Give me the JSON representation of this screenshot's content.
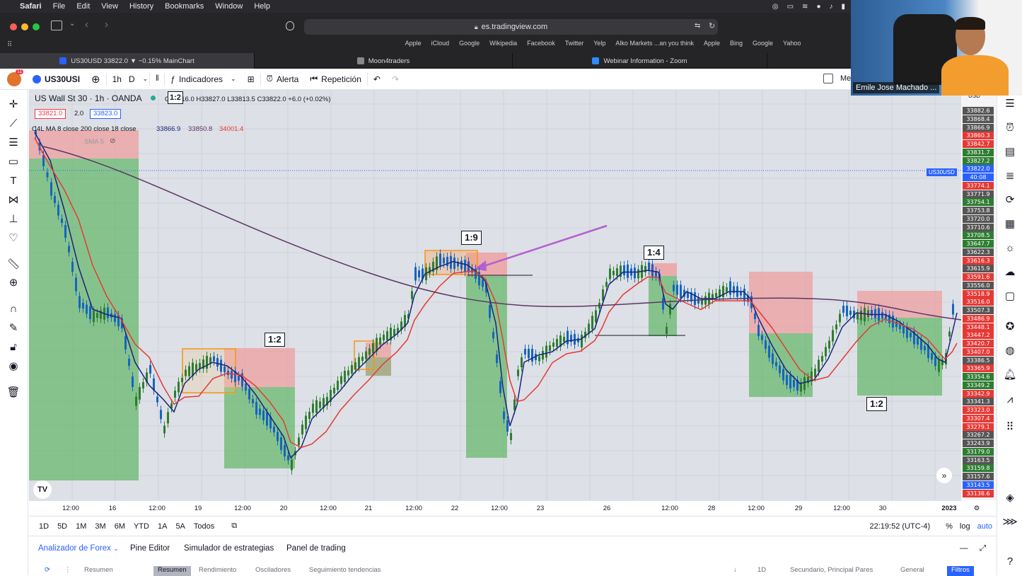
{
  "menubar": {
    "app": "Safari",
    "items": [
      "File",
      "Edit",
      "View",
      "History",
      "Bookmarks",
      "Window",
      "Help"
    ]
  },
  "safari": {
    "url": "es.tradingview.com",
    "favorites": [
      "Apple",
      "iCloud",
      "Google",
      "Wikipedia",
      "Facebook",
      "Twitter",
      "Yelp",
      "Alko Markets ...an you think",
      "Apple",
      "Bing",
      "Google",
      "Yahoo"
    ],
    "tabs": [
      {
        "label": "US30USD 33822.0 ▼ −0.15% MainChart",
        "color": "#2962ff"
      },
      {
        "label": "Moon4traders",
        "color": "#888888"
      },
      {
        "label": "Webinar Information - Zoom",
        "color": "#2d8cff"
      },
      {
        "label": "",
        "color": ""
      }
    ]
  },
  "tvtoolbar": {
    "avatar_badge": "11",
    "symbol": "US30USI",
    "interval": "1h",
    "chart_style_label": "D",
    "indicators": "Indicadores",
    "alert": "Alerta",
    "replay": "Repetición",
    "right_text": "Me"
  },
  "legend": {
    "title": "US Wall St 30 · 1h · OANDA",
    "ohlc": "O33816.0 H33827.0 L33813.5 C33822.0 +6.0 (+0.02%)",
    "bid": "33821.0",
    "spread": "2.0",
    "ask": "33823.0",
    "indicator_name": "C4L MA 8 close 200 close 18 close",
    "ma_values": [
      "33866.9",
      "33850.8",
      "34001.4"
    ],
    "ma_colors": [
      "#1a237e",
      "#5c3566",
      "#e53935"
    ],
    "sma_label": "SMA 5",
    "box_label": "1:2"
  },
  "annotations": [
    "1:2",
    "1:9",
    "1:4",
    "1:2"
  ],
  "price_axis": {
    "currency": "USD",
    "symbol_tag": "US30USD",
    "labels": [
      {
        "v": "33882.6",
        "c": "#555555"
      },
      {
        "v": "33868.4",
        "c": "#555555"
      },
      {
        "v": "33866.9",
        "c": "#555555"
      },
      {
        "v": "33860.3",
        "c": "#e53935"
      },
      {
        "v": "33842.7",
        "c": "#e53935"
      },
      {
        "v": "33831.7",
        "c": "#2e7d32"
      },
      {
        "v": "33827.2",
        "c": "#2e7d32"
      },
      {
        "v": "33822.0",
        "c": "#2962ff"
      },
      {
        "v": "40:08",
        "c": "#2962ff"
      },
      {
        "v": "33774.1",
        "c": "#e53935"
      },
      {
        "v": "33771.9",
        "c": "#555555"
      },
      {
        "v": "33754.1",
        "c": "#2e7d32"
      },
      {
        "v": "33753.8",
        "c": "#555555"
      },
      {
        "v": "33720.0",
        "c": "#555555"
      },
      {
        "v": "33710.6",
        "c": "#555555"
      },
      {
        "v": "33708.5",
        "c": "#2e7d32"
      },
      {
        "v": "33647.7",
        "c": "#2e7d32"
      },
      {
        "v": "33622.3",
        "c": "#555555"
      },
      {
        "v": "33616.3",
        "c": "#e53935"
      },
      {
        "v": "33615.9",
        "c": "#555555"
      },
      {
        "v": "33591.6",
        "c": "#e53935"
      },
      {
        "v": "33556.0",
        "c": "#555555"
      },
      {
        "v": "33518.9",
        "c": "#e53935"
      },
      {
        "v": "33516.0",
        "c": "#e53935"
      },
      {
        "v": "33507.3",
        "c": "#555555"
      },
      {
        "v": "33486.9",
        "c": "#e53935"
      },
      {
        "v": "33448.1",
        "c": "#e53935"
      },
      {
        "v": "33447.2",
        "c": "#e53935"
      },
      {
        "v": "33420.7",
        "c": "#e53935"
      },
      {
        "v": "33407.0",
        "c": "#e53935"
      },
      {
        "v": "33386.5",
        "c": "#555555"
      },
      {
        "v": "33365.9",
        "c": "#e53935"
      },
      {
        "v": "33354.6",
        "c": "#2e7d32"
      },
      {
        "v": "33349.2",
        "c": "#2e7d32"
      },
      {
        "v": "33342.9",
        "c": "#e53935"
      },
      {
        "v": "33341.3",
        "c": "#555555"
      },
      {
        "v": "33323.0",
        "c": "#e53935"
      },
      {
        "v": "33307.4",
        "c": "#e53935"
      },
      {
        "v": "33279.1",
        "c": "#e53935"
      },
      {
        "v": "33267.2",
        "c": "#555555"
      },
      {
        "v": "33243.9",
        "c": "#555555"
      },
      {
        "v": "33179.0",
        "c": "#2e7d32"
      },
      {
        "v": "33163.5",
        "c": "#555555"
      },
      {
        "v": "33159.8",
        "c": "#2e7d32"
      },
      {
        "v": "33157.6",
        "c": "#555555"
      },
      {
        "v": "33143.5",
        "c": "#2962ff"
      },
      {
        "v": "33138.6",
        "c": "#e53935"
      }
    ]
  },
  "time_axis": [
    "12:00",
    "16",
    "12:00",
    "19",
    "12:00",
    "20",
    "12:00",
    "21",
    "12:00",
    "22",
    "12:00",
    "23",
    "26",
    "12:00",
    "28",
    "12:00",
    "29",
    "12:00",
    "30",
    "2023"
  ],
  "range_bar": {
    "ranges": [
      "1D",
      "5D",
      "1M",
      "3M",
      "6M",
      "YTD",
      "1A",
      "5A",
      "Todos"
    ],
    "clock": "22:19:52 (UTC-4)",
    "percent": "%",
    "log": "log",
    "auto": "auto"
  },
  "bottom_panel": {
    "tabs": [
      "Analizador de Forex",
      "Pine Editor",
      "Simulador de estrategias",
      "Panel de trading"
    ],
    "sub": [
      "Resumen",
      "Resumen",
      "Rendimiento",
      "Osciladores",
      "Seguimiento tendencias"
    ],
    "right": [
      "1D",
      "Secundario, Principal Pares",
      "General",
      "Filtros"
    ]
  },
  "webcam": {
    "name": "Emile Jose Machado ..."
  },
  "colors": {
    "chart_bg": "#dde0e6",
    "up": "#2e7d32",
    "down": "#1565c0",
    "ma_fast": "#1a237e",
    "ma_slow": "#e53935",
    "ma_long": "#5c3566",
    "profit_zone": "#4caf50",
    "loss_zone": "#ef9a9a"
  }
}
